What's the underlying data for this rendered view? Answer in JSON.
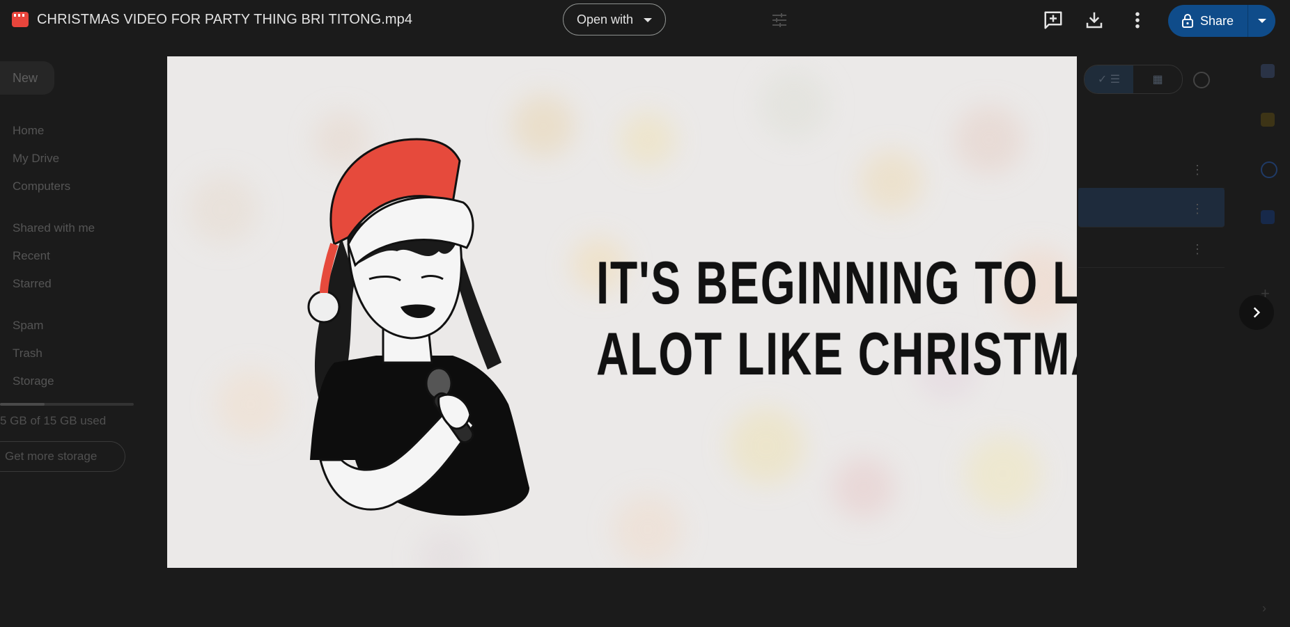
{
  "viewer": {
    "file_title": "CHRISTMAS VIDEO FOR PARTY THING BRI TITONG.mp4",
    "file_icon": "video-file-icon",
    "open_with_label": "Open with",
    "share_label": "Share",
    "icons": [
      "add-comment-icon",
      "download-icon",
      "more-vert-icon",
      "lock-icon",
      "tune-icon",
      "chevron-right-icon"
    ]
  },
  "video": {
    "caption_lines": [
      "IT'S BEGINNING TO LOOK",
      "ALOT LIKE CHRISTMAS"
    ]
  },
  "background_drive": {
    "new_label": "New",
    "nav_items": [
      "Home",
      "My Drive",
      "Computers",
      "Shared with me",
      "Recent",
      "Starred",
      "Spam",
      "Trash",
      "Storage"
    ],
    "storage_text": "5 GB of 15 GB used",
    "storage_fraction": 0.33,
    "get_more_storage_label": "Get more storage"
  },
  "colors": {
    "share_button": "#0f4c8a",
    "file_icon": "#e8453c",
    "page_background": "#1b1b1b"
  }
}
